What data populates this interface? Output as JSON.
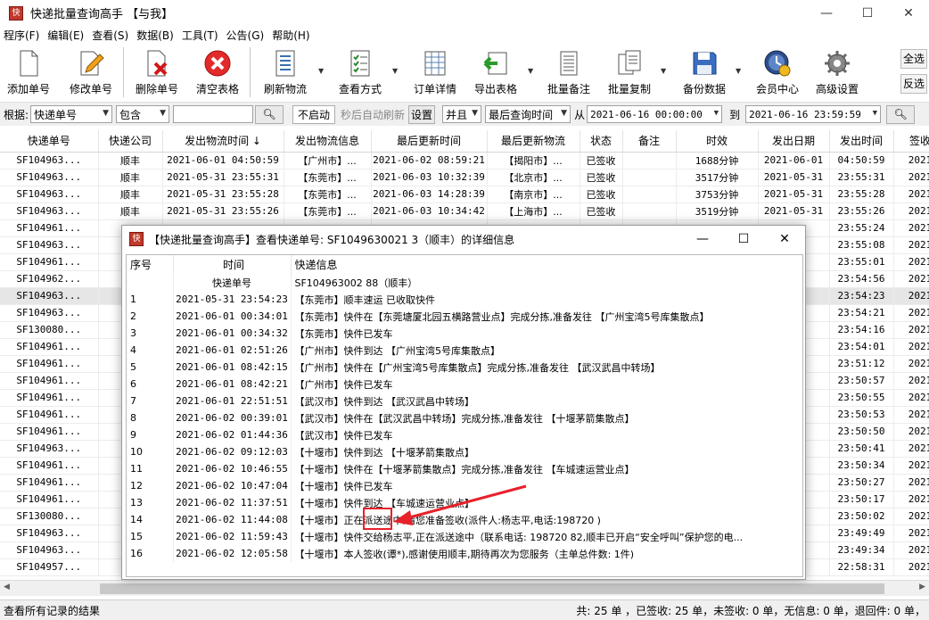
{
  "window": {
    "title": "快递批量查询高手 【与我】"
  },
  "menu": [
    "程序(F)",
    "编辑(E)",
    "查看(S)",
    "数据(B)",
    "工具(T)",
    "公告(G)",
    "帮助(H)"
  ],
  "toolbar": {
    "add": "添加单号",
    "edit": "修改单号",
    "delete": "删除单号",
    "clear": "清空表格",
    "refresh": "刷新物流",
    "view": "查看方式",
    "detail": "订单详情",
    "export": "导出表格",
    "batch_note": "批量备注",
    "batch_copy": "批量复制",
    "backup": "备份数据",
    "member": "会员中心",
    "settings": "高级设置",
    "select_all": "全选",
    "invert": "反选"
  },
  "filter": {
    "by_label": "根据:",
    "field": "快递单号",
    "match": "包含",
    "query": "",
    "auto_refresh_btn": "不启动",
    "auto_refresh_text": "秒后自动刷新",
    "settings_btn": "设置",
    "logic": "并且",
    "time_field": "最后查询时间",
    "from_label": "从",
    "from": "2021-06-16 00:00:00",
    "to_label": "到",
    "to": "2021-06-16 23:59:59"
  },
  "grid": {
    "columns": [
      "快递单号",
      "快递公司",
      "发出物流时间 ↓",
      "发出物流信息",
      "最后更新时间",
      "最后更新物流",
      "状态",
      "备注",
      "时效",
      "发出日期",
      "发出时间",
      "签收"
    ],
    "rows": [
      [
        "SF104963...",
        "顺丰",
        "2021-06-01 04:50:59",
        "【广州市】...",
        "2021-06-02 08:59:21",
        "【揭阳市】...",
        "已签收",
        "",
        "1688分钟",
        "2021-06-01",
        "04:50:59",
        "2021"
      ],
      [
        "SF104963...",
        "顺丰",
        "2021-05-31 23:55:31",
        "【东莞市】...",
        "2021-06-03 10:32:39",
        "【北京市】...",
        "已签收",
        "",
        "3517分钟",
        "2021-05-31",
        "23:55:31",
        "2021"
      ],
      [
        "SF104963...",
        "顺丰",
        "2021-05-31 23:55:28",
        "【东莞市】...",
        "2021-06-03 14:28:39",
        "【南京市】...",
        "已签收",
        "",
        "3753分钟",
        "2021-05-31",
        "23:55:28",
        "2021"
      ],
      [
        "SF104963...",
        "顺丰",
        "2021-05-31 23:55:26",
        "【东莞市】...",
        "2021-06-03 10:34:42",
        "【上海市】...",
        "已签收",
        "",
        "3519分钟",
        "2021-05-31",
        "23:55:26",
        "2021"
      ],
      [
        "SF104961...",
        "",
        "",
        "",
        "",
        "",
        "",
        "",
        "",
        "",
        "23:55:24",
        "2021"
      ],
      [
        "SF104963...",
        "",
        "",
        "",
        "",
        "",
        "",
        "",
        "",
        "",
        "23:55:08",
        "2021"
      ],
      [
        "SF104961...",
        "",
        "",
        "",
        "",
        "",
        "",
        "",
        "",
        "",
        "23:55:01",
        "2021"
      ],
      [
        "SF104962...",
        "",
        "",
        "",
        "",
        "",
        "",
        "",
        "",
        "",
        "23:54:56",
        "2021"
      ],
      [
        "SF104963...",
        "",
        "",
        "",
        "",
        "",
        "",
        "",
        "",
        "",
        "23:54:23",
        "2021"
      ],
      [
        "SF104963...",
        "",
        "",
        "",
        "",
        "",
        "",
        "",
        "",
        "",
        "23:54:21",
        "2021"
      ],
      [
        "SF130080...",
        "",
        "",
        "",
        "",
        "",
        "",
        "",
        "",
        "",
        "23:54:16",
        "2021"
      ],
      [
        "SF104961...",
        "",
        "",
        "",
        "",
        "",
        "",
        "",
        "",
        "",
        "23:54:01",
        "2021"
      ],
      [
        "SF104961...",
        "",
        "",
        "",
        "",
        "",
        "",
        "",
        "",
        "",
        "23:51:12",
        "2021"
      ],
      [
        "SF104961...",
        "",
        "",
        "",
        "",
        "",
        "",
        "",
        "",
        "",
        "23:50:57",
        "2021"
      ],
      [
        "SF104961...",
        "",
        "",
        "",
        "",
        "",
        "",
        "",
        "",
        "",
        "23:50:55",
        "2021"
      ],
      [
        "SF104961...",
        "",
        "",
        "",
        "",
        "",
        "",
        "",
        "",
        "",
        "23:50:53",
        "2021"
      ],
      [
        "SF104961...",
        "",
        "",
        "",
        "",
        "",
        "",
        "",
        "",
        "",
        "23:50:50",
        "2021"
      ],
      [
        "SF104963...",
        "",
        "",
        "",
        "",
        "",
        "",
        "",
        "",
        "",
        "23:50:41",
        "2021"
      ],
      [
        "SF104961...",
        "",
        "",
        "",
        "",
        "",
        "",
        "",
        "",
        "",
        "23:50:34",
        "2021"
      ],
      [
        "SF104961...",
        "",
        "",
        "",
        "",
        "",
        "",
        "",
        "",
        "",
        "23:50:27",
        "2021"
      ],
      [
        "SF104961...",
        "",
        "",
        "",
        "",
        "",
        "",
        "",
        "",
        "",
        "23:50:17",
        "2021"
      ],
      [
        "SF130080...",
        "",
        "",
        "",
        "",
        "",
        "",
        "",
        "",
        "",
        "23:50:02",
        "2021"
      ],
      [
        "SF104963...",
        "",
        "",
        "",
        "",
        "",
        "",
        "",
        "",
        "",
        "23:49:49",
        "2021"
      ],
      [
        "SF104963...",
        "",
        "",
        "",
        "",
        "",
        "",
        "",
        "",
        "",
        "23:49:34",
        "2021"
      ],
      [
        "SF104957...",
        "",
        "",
        "",
        "",
        "",
        "",
        "",
        "",
        "",
        "22:58:31",
        "2021"
      ]
    ]
  },
  "dialog": {
    "title": "【快递批量查询高手】查看快递单号: SF1049630021  3（顺丰）的详细信息",
    "columns": [
      "序号",
      "时间",
      "快递信息"
    ],
    "header_time": "快递单号",
    "header_info": "SF104963002  88（顺丰）",
    "rows": [
      [
        "1",
        "2021-05-31 23:54:23",
        "【东莞市】顺丰速运 已收取快件"
      ],
      [
        "2",
        "2021-06-01 00:34:01",
        "【东莞市】快件在【东莞塘厦北园五横路营业点】完成分拣,准备发往 【广州宝湾5号库集散点】"
      ],
      [
        "3",
        "2021-06-01 00:34:32",
        "【东莞市】快件已发车"
      ],
      [
        "4",
        "2021-06-01 02:51:26",
        "【广州市】快件到达 【广州宝湾5号库集散点】"
      ],
      [
        "5",
        "2021-06-01 08:42:15",
        "【广州市】快件在【广州宝湾5号库集散点】完成分拣,准备发往 【武汉武昌中转场】"
      ],
      [
        "6",
        "2021-06-01 08:42:21",
        "【广州市】快件已发车"
      ],
      [
        "7",
        "2021-06-01 22:51:51",
        "【武汉市】快件到达 【武汉武昌中转场】"
      ],
      [
        "8",
        "2021-06-02 00:39:01",
        "【武汉市】快件在【武汉武昌中转场】完成分拣,准备发往 【十堰茅箭集散点】"
      ],
      [
        "9",
        "2021-06-02 01:44:36",
        "【武汉市】快件已发车"
      ],
      [
        "10",
        "2021-06-02 09:12:03",
        "【十堰市】快件到达 【十堰茅箭集散点】"
      ],
      [
        "11",
        "2021-06-02 10:46:55",
        "【十堰市】快件在【十堰茅箭集散点】完成分拣,准备发往 【车城速运营业点】"
      ],
      [
        "12",
        "2021-06-02 10:47:04",
        "【十堰市】快件已发车"
      ],
      [
        "13",
        "2021-06-02 11:37:51",
        "【十堰市】快件到达 【车城速运营业点】"
      ],
      [
        "14",
        "2021-06-02 11:44:08",
        "【十堰市】正在派送途中,请您准备签收(派件人:杨志平,电话:198720    )"
      ],
      [
        "15",
        "2021-06-02 11:59:43",
        "【十堰市】快件交给杨志平,正在派送途中（联系电话: 198720    82,顺丰已开启“安全呼叫”保护您的电..."
      ],
      [
        "16",
        "2021-06-02 12:05:58",
        "【十堰市】本人签收(谭*),感谢使用顺丰,期待再次为您服务（主单总件数: 1件)"
      ]
    ]
  },
  "status": {
    "left": "查看所有记录的结果",
    "right": "共: 25 单 ，已签收: 25 单，未签收: 0 单，无信息: 0 单，退回件: 0 单，"
  },
  "colors": {
    "accent": "#e8202a",
    "selected_row": "#e6e6e6"
  }
}
